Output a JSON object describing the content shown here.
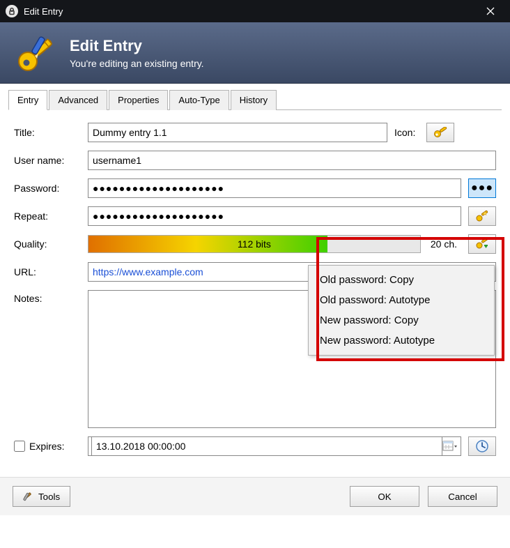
{
  "window": {
    "title": "Edit Entry"
  },
  "header": {
    "title": "Edit Entry",
    "subtitle": "You're editing an existing entry."
  },
  "tabs": [
    "Entry",
    "Advanced",
    "Properties",
    "Auto-Type",
    "History"
  ],
  "labels": {
    "title": "Title:",
    "username": "User name:",
    "password": "Password:",
    "repeat": "Repeat:",
    "quality": "Quality:",
    "url": "URL:",
    "notes": "Notes:",
    "expires": "Expires:",
    "icon": "Icon:"
  },
  "fields": {
    "title": "Dummy entry 1.1",
    "username": "username1",
    "password_masked": "●●●●●●●●●●●●●●●●●●●●",
    "repeat_masked": "●●●●●●●●●●●●●●●●●●●●",
    "quality_bits": "112 bits",
    "char_count": "20 ch.",
    "url": "https://www.example.com",
    "notes": "",
    "expires_date": "13.10.2018 00:00:00"
  },
  "menu": {
    "items": [
      "Old password: Copy",
      "Old password: Autotype",
      "New password: Copy",
      "New password: Autotype"
    ]
  },
  "buttons": {
    "tools": "Tools",
    "ok": "OK",
    "cancel": "Cancel"
  }
}
